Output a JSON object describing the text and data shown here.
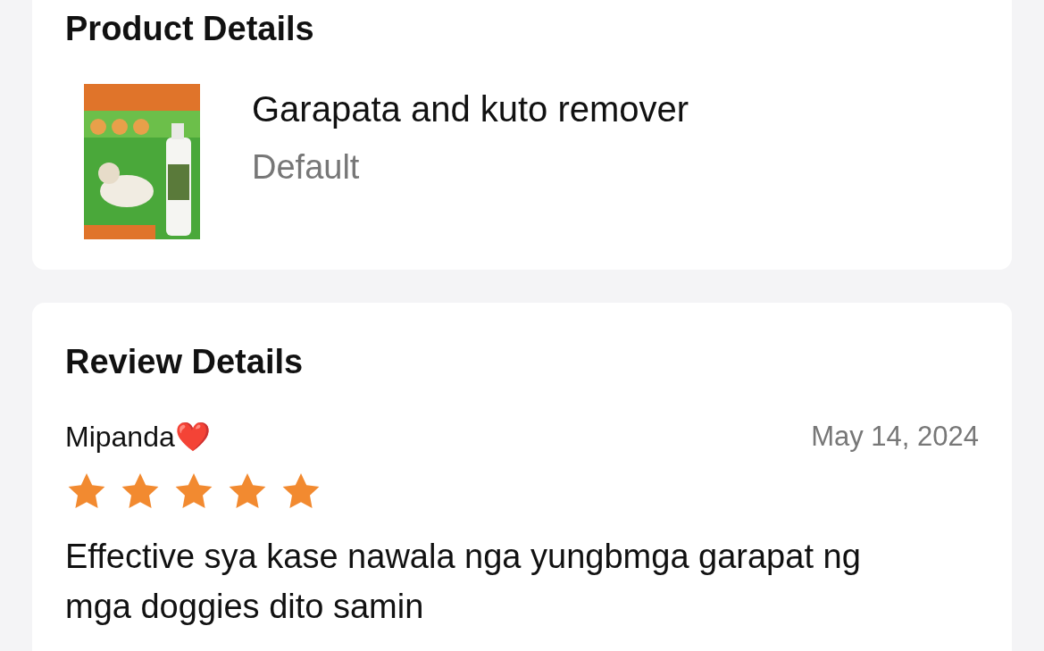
{
  "product_details": {
    "title": "Product Details",
    "product": {
      "kind": "picture",
      "name": "Garapata and kuto remover",
      "variant": "Default"
    }
  },
  "review_details": {
    "title": "Review Details",
    "review": {
      "user": "Mipanda❤️",
      "date": "May 14, 2024",
      "stars": 5,
      "text": "Effective sya kase nawala nga yungbmga garapat ng mga doggies dito samin"
    }
  }
}
